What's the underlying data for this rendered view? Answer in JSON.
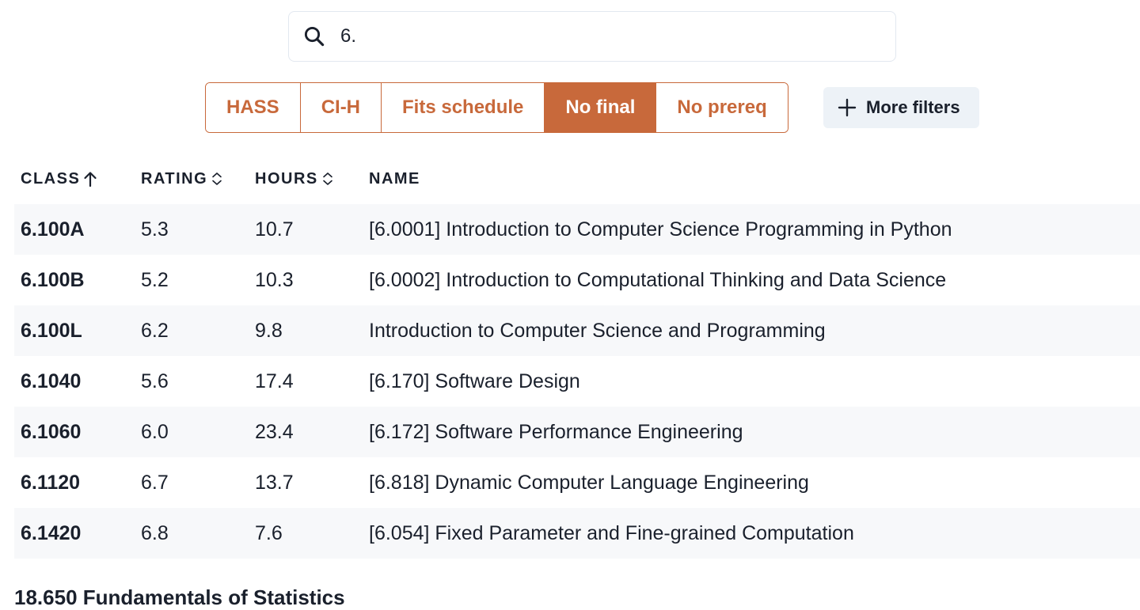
{
  "search": {
    "value": "6.",
    "icon": "search-icon"
  },
  "filters": [
    {
      "label": "HASS",
      "active": false
    },
    {
      "label": "CI-H",
      "active": false
    },
    {
      "label": "Fits schedule",
      "active": false
    },
    {
      "label": "No final",
      "active": true
    },
    {
      "label": "No prereq",
      "active": false
    }
  ],
  "more_filters": {
    "label": "More filters",
    "icon": "plus-icon"
  },
  "table": {
    "headers": {
      "class": "CLASS",
      "rating": "RATING",
      "hours": "HOURS",
      "name": "NAME"
    },
    "sort": {
      "column": "class",
      "direction": "ascending"
    },
    "rows": [
      {
        "class": "6.100A",
        "rating": "5.3",
        "hours": "10.7",
        "name": "[6.0001] Introduction to Computer Science Programming in Python"
      },
      {
        "class": "6.100B",
        "rating": "5.2",
        "hours": "10.3",
        "name": "[6.0002] Introduction to Computational Thinking and Data Science"
      },
      {
        "class": "6.100L",
        "rating": "6.2",
        "hours": "9.8",
        "name": "Introduction to Computer Science and Programming"
      },
      {
        "class": "6.1040",
        "rating": "5.6",
        "hours": "17.4",
        "name": "[6.170] Software Design"
      },
      {
        "class": "6.1060",
        "rating": "6.0",
        "hours": "23.4",
        "name": "[6.172] Software Performance Engineering"
      },
      {
        "class": "6.1120",
        "rating": "6.7",
        "hours": "13.7",
        "name": "[6.818] Dynamic Computer Language Engineering"
      },
      {
        "class": "6.1420",
        "rating": "6.8",
        "hours": "7.6",
        "name": "[6.054] Fixed Parameter and Fine-grained Computation"
      }
    ]
  },
  "footer_peek": "18.650 Fundamentals of Statistics",
  "colors": {
    "accent": "#c8693b",
    "row_stripe": "#f7f8fa",
    "button_gray": "#edf2f7",
    "text": "#1a202c"
  }
}
